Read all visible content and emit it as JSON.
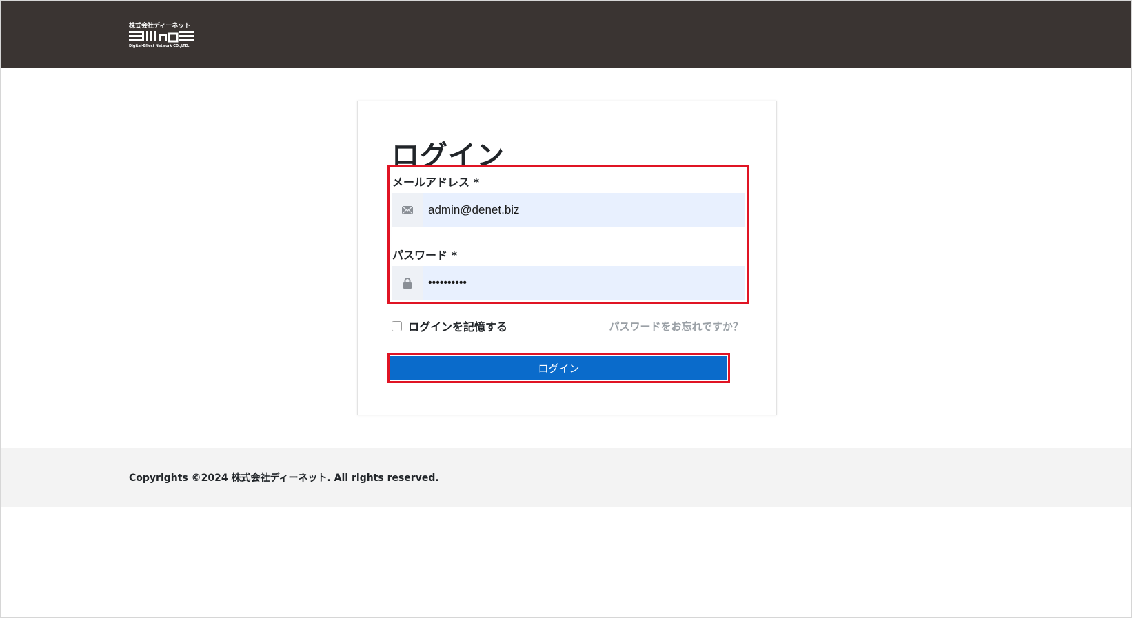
{
  "header": {
    "logo_company_name": "株式会社ディーネット",
    "logo_wordmark": "Denet",
    "logo_tagline": "Digital-Effect Network CO.,LTD."
  },
  "login_form": {
    "title": "ログイン",
    "email": {
      "label": "メールアドレス *",
      "value": "admin@denet.biz",
      "icon": "envelope-icon"
    },
    "password": {
      "label": "パスワード *",
      "value": "••••••••••",
      "icon": "lock-icon"
    },
    "remember_label": "ログインを記憶する",
    "remember_checked": false,
    "forgot_link": "パスワードをお忘れですか？",
    "submit_label": "ログイン"
  },
  "footer": {
    "copyright": "Copyrights ©2024 株式会社ディーネット. All rights reserved."
  },
  "colors": {
    "header_bg": "#3a3432",
    "primary_button": "#0a6bcb",
    "highlight_border": "#e01424",
    "input_bg": "#e8f0fe",
    "footer_bg": "#f3f3f3"
  }
}
